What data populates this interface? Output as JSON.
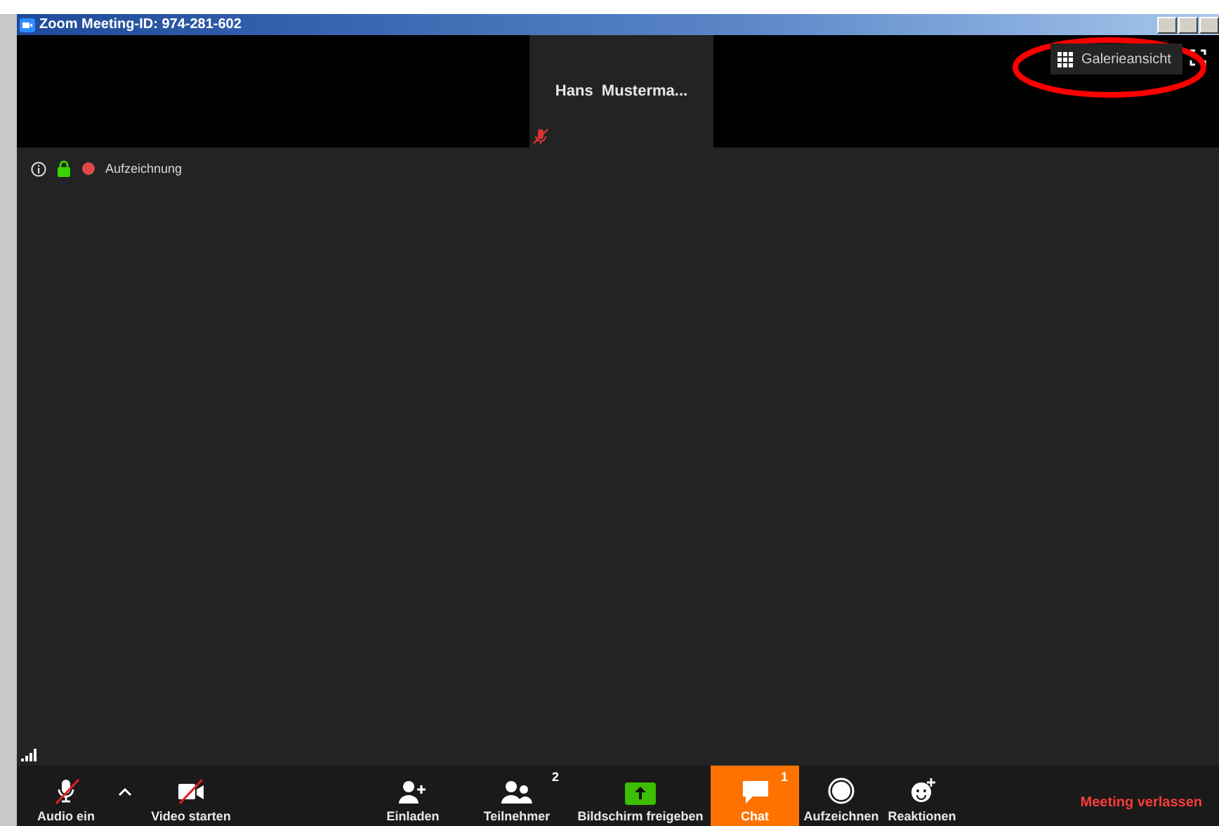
{
  "window": {
    "title": "Zoom Meeting-ID: 974-281-602"
  },
  "participant_tile": {
    "name": "Hans  Musterma...",
    "muted": true
  },
  "gallery_button": {
    "label": "Galerieansicht"
  },
  "annotation": {
    "kind": "ellipse",
    "color": "#ff0000"
  },
  "info_bar": {
    "recording_label": "Aufzeichnung"
  },
  "toolbar": [
    {
      "kind": "audio",
      "label": "Audio ein",
      "muted": true,
      "selected": false
    },
    {
      "kind": "caret"
    },
    {
      "kind": "video",
      "label": "Video starten",
      "muted": true,
      "selected": false
    },
    {
      "kind": "invite",
      "label": "Einladen",
      "selected": false
    },
    {
      "kind": "participants",
      "label": "Teilnehmer",
      "badge": "2",
      "selected": false
    },
    {
      "kind": "share",
      "label": "Bildschirm freigeben",
      "selected": false
    },
    {
      "kind": "chat",
      "label": "Chat",
      "badge": "1",
      "selected": true
    },
    {
      "kind": "record",
      "label": "Aufzeichnen",
      "selected": false
    },
    {
      "kind": "reactions",
      "label": "Reaktionen",
      "selected": false
    }
  ],
  "leave_button": {
    "label": "Meeting verlassen"
  }
}
